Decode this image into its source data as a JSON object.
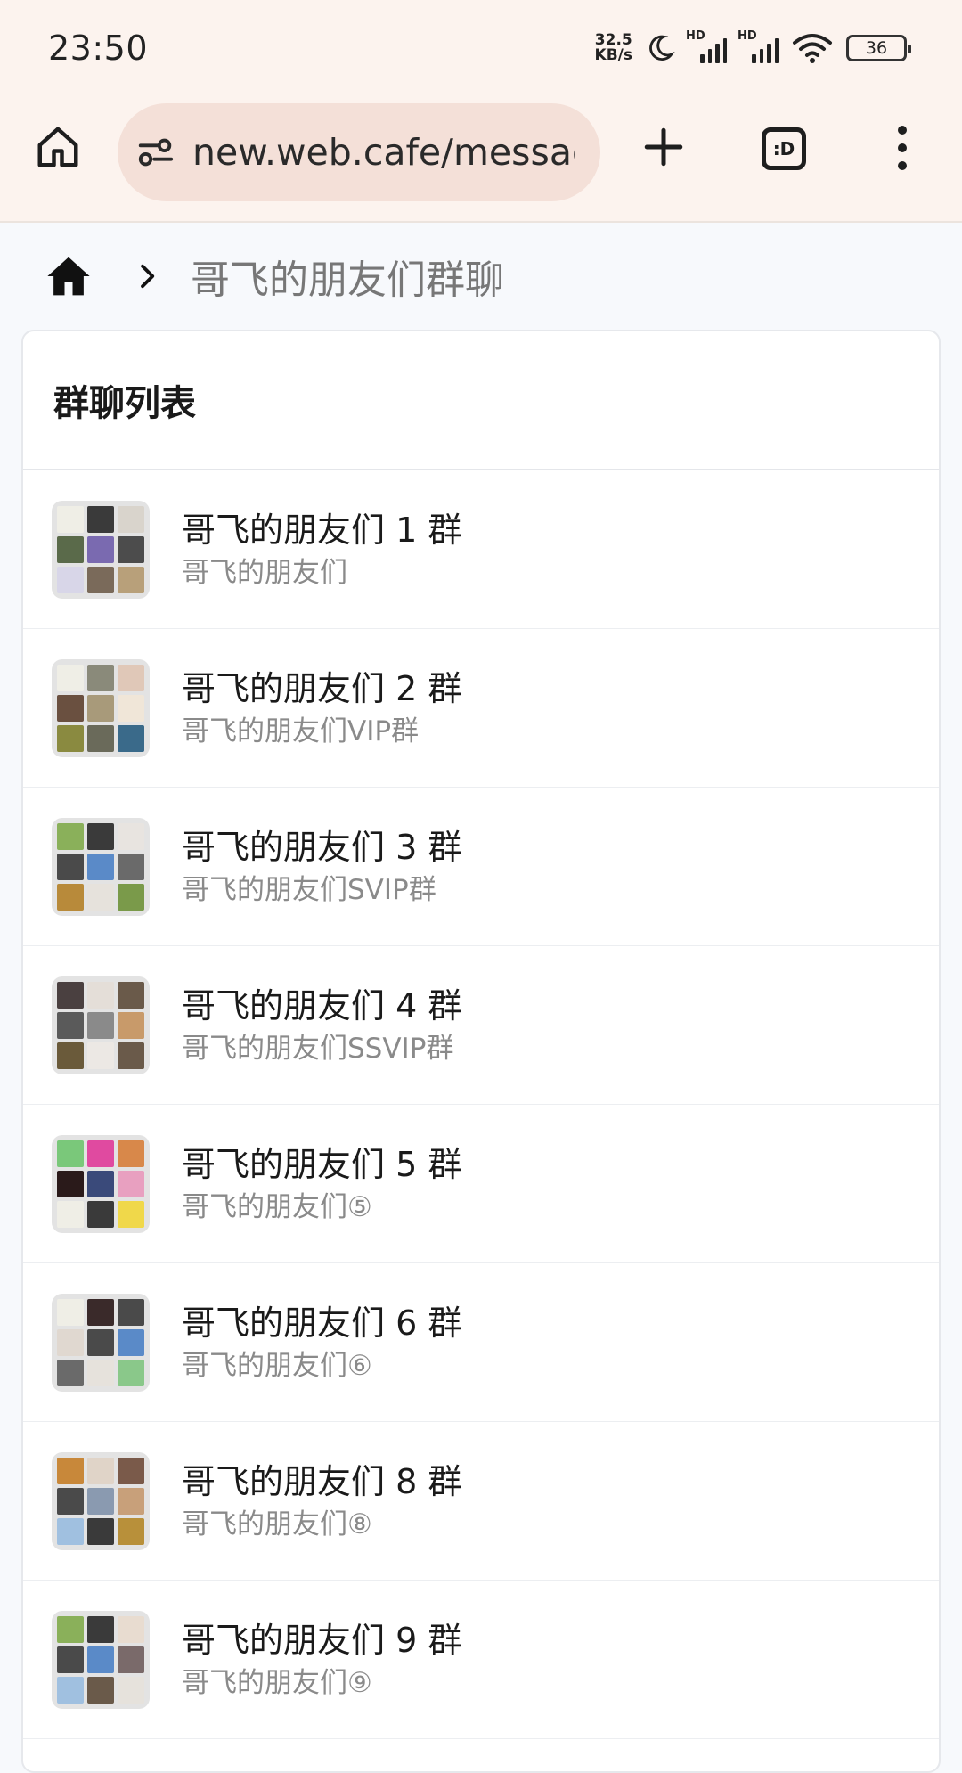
{
  "status_bar": {
    "time": "23:50",
    "net_speed_value": "32.5",
    "net_speed_unit": "KB/s",
    "signal_label": "HD",
    "battery": "36"
  },
  "browser": {
    "url": "new.web.cafe/messag",
    "tabs_label": ":D"
  },
  "breadcrumb": {
    "title": "哥飞的朋友们群聊"
  },
  "card": {
    "title": "群聊列表"
  },
  "groups": [
    {
      "name": "哥飞的朋友们 1 群",
      "desc": "哥飞的朋友们",
      "tiles": [
        "#efeee6",
        "#3a3a3a",
        "#d9d4cc",
        "#5a6a4a",
        "#7a6ab0",
        "#4c4c4c",
        "#d8d6e8",
        "#7a6a5a",
        "#b8a07a"
      ]
    },
    {
      "name": "哥飞的朋友们 2 群",
      "desc": "哥飞的朋友们VIP群",
      "tiles": [
        "#efeee6",
        "#8a8a7a",
        "#e0c8b8",
        "#6a5040",
        "#a89a7a",
        "#f0e6d8",
        "#8a8a40",
        "#6a6a5a",
        "#3a6a8a"
      ]
    },
    {
      "name": "哥飞的朋友们 3 群",
      "desc": "哥飞的朋友们SVIP群",
      "tiles": [
        "#8ab05a",
        "#3a3a3a",
        "#e8e4e0",
        "#4a4a4a",
        "#5a8ac8",
        "#6a6a6a",
        "#b88a3a",
        "#e6e2dc",
        "#7a9a4a"
      ]
    },
    {
      "name": "哥飞的朋友们 4 群",
      "desc": "哥飞的朋友们SSVIP群",
      "tiles": [
        "#4a4040",
        "#e4ded8",
        "#6a5a4a",
        "#5a5a5a",
        "#8a8a8a",
        "#c89a6a",
        "#6a5a3a",
        "#ece8e4",
        "#6a5a4a"
      ]
    },
    {
      "name": "哥飞的朋友们 5 群",
      "desc": "哥飞的朋友们⑤",
      "tiles": [
        "#7ac87a",
        "#e04aa0",
        "#d8884a",
        "#2a1a1a",
        "#3a4a7a",
        "#e8a0c0",
        "#efeee6",
        "#3a3a3a",
        "#f0d84a"
      ]
    },
    {
      "name": "哥飞的朋友们 6 群",
      "desc": "哥飞的朋友们⑥",
      "tiles": [
        "#efeee6",
        "#3a2a2a",
        "#4a4a4a",
        "#e0d8d0",
        "#4a4a4a",
        "#5a8ac8",
        "#6a6a6a",
        "#e6e2dc",
        "#8ac88a"
      ]
    },
    {
      "name": "哥飞的朋友们 8 群",
      "desc": "哥飞的朋友们⑧",
      "tiles": [
        "#c8883a",
        "#e0d4c8",
        "#7a5a4a",
        "#4a4a4a",
        "#8a9ab0",
        "#c8a07a",
        "#a0c0e0",
        "#3a3a3a",
        "#b8903a"
      ]
    },
    {
      "name": "哥飞的朋友们 9 群",
      "desc": "哥飞的朋友们⑨",
      "tiles": [
        "#8ab05a",
        "#3a3a3a",
        "#e8dcd0",
        "#4a4a4a",
        "#5a8ac8",
        "#7a6a6a",
        "#a0c0e0",
        "#6a5a4a",
        "#e6e2dc"
      ]
    }
  ]
}
